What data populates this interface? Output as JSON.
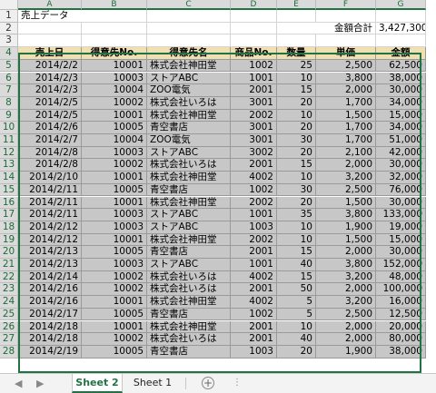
{
  "columns": [
    "A",
    "B",
    "C",
    "D",
    "E",
    "F",
    "G"
  ],
  "row_numbers": [
    "1",
    "2",
    "3",
    "4",
    "5",
    "6",
    "7",
    "8",
    "9",
    "10",
    "11",
    "12",
    "13",
    "14",
    "15",
    "16",
    "17",
    "18",
    "19",
    "20",
    "21",
    "22",
    "23",
    "24",
    "25",
    "26",
    "27",
    "28"
  ],
  "title": "売上データ",
  "total_label": "金額合計",
  "total_value": "3,427,300",
  "headers": [
    "売上日",
    "得意先No.",
    "得意先名",
    "商品No.",
    "数量",
    "単価",
    "金額"
  ],
  "rows": [
    [
      "2014/2/2",
      "10001",
      "株式会社神田堂",
      "1002",
      "25",
      "2,500",
      "62,500"
    ],
    [
      "2014/2/3",
      "10003",
      "ストアABC",
      "1001",
      "10",
      "3,800",
      "38,000"
    ],
    [
      "2014/2/3",
      "10004",
      "ZOO電気",
      "2001",
      "15",
      "2,000",
      "30,000"
    ],
    [
      "2014/2/5",
      "10002",
      "株式会社いろは",
      "3001",
      "20",
      "1,700",
      "34,000"
    ],
    [
      "2014/2/5",
      "10001",
      "株式会社神田堂",
      "2002",
      "10",
      "1,500",
      "15,000"
    ],
    [
      "2014/2/6",
      "10005",
      "青空書店",
      "3001",
      "20",
      "1,700",
      "34,000"
    ],
    [
      "2014/2/7",
      "10004",
      "ZOO電気",
      "3001",
      "30",
      "1,700",
      "51,000"
    ],
    [
      "2014/2/8",
      "10003",
      "ストアABC",
      "3002",
      "20",
      "2,100",
      "42,000"
    ],
    [
      "2014/2/8",
      "10002",
      "株式会社いろは",
      "2001",
      "15",
      "2,000",
      "30,000"
    ],
    [
      "2014/2/10",
      "10001",
      "株式会社神田堂",
      "4002",
      "10",
      "3,200",
      "32,000"
    ],
    [
      "2014/2/11",
      "10005",
      "青空書店",
      "1002",
      "30",
      "2,500",
      "76,000"
    ],
    [
      "2014/2/11",
      "10001",
      "株式会社神田堂",
      "2002",
      "20",
      "1,500",
      "30,000"
    ],
    [
      "2014/2/11",
      "10003",
      "ストアABC",
      "1001",
      "35",
      "3,800",
      "133,000"
    ],
    [
      "2014/2/12",
      "10003",
      "ストアABC",
      "1003",
      "10",
      "1,900",
      "19,000"
    ],
    [
      "2014/2/12",
      "10001",
      "株式会社神田堂",
      "2002",
      "10",
      "1,500",
      "15,000"
    ],
    [
      "2014/2/13",
      "10005",
      "青空書店",
      "2001",
      "15",
      "2,000",
      "30,000"
    ],
    [
      "2014/2/13",
      "10003",
      "ストアABC",
      "1001",
      "40",
      "3,800",
      "152,000"
    ],
    [
      "2014/2/14",
      "10002",
      "株式会社いろは",
      "4002",
      "15",
      "3,200",
      "48,000"
    ],
    [
      "2014/2/16",
      "10002",
      "株式会社いろは",
      "2001",
      "50",
      "2,000",
      "100,000"
    ],
    [
      "2014/2/16",
      "10001",
      "株式会社神田堂",
      "4002",
      "5",
      "3,200",
      "16,000"
    ],
    [
      "2014/2/17",
      "10005",
      "青空書店",
      "1002",
      "5",
      "2,500",
      "12,500"
    ],
    [
      "2014/2/18",
      "10001",
      "株式会社神田堂",
      "2001",
      "10",
      "2,000",
      "20,000"
    ],
    [
      "2014/2/18",
      "10002",
      "株式会社いろは",
      "2001",
      "40",
      "2,000",
      "80,000"
    ],
    [
      "2014/2/19",
      "10005",
      "青空書店",
      "1003",
      "20",
      "1,900",
      "38,000"
    ]
  ],
  "tabs": {
    "nav_prev": "◀",
    "nav_next": "▶",
    "sheet2": "Sheet 2",
    "sheet1": "Sheet 1",
    "add": "+",
    "more": "⋮"
  }
}
